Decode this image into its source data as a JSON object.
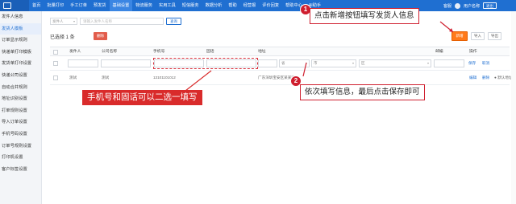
{
  "nav": {
    "items": [
      "首页",
      "批量打印",
      "手工订单",
      "预发货",
      "基础设置",
      "物流服务",
      "实用工具",
      "短信服务",
      "数据分析",
      "帮助",
      "经营报",
      "评价回复",
      "帮助中心",
      "AI助手"
    ],
    "active_index": 4,
    "right": {
      "label1": "客服",
      "user": "用户名称",
      "btn": "退出"
    }
  },
  "sidebar": {
    "items": [
      "发件人信息",
      "发货人模板",
      "订单显示规则",
      "快递单打印模板",
      "发货单打印设置",
      "快递公司设置",
      "自动合并规则",
      "地址识别设置",
      "打单规则设置",
      "导入订单设置",
      "手机号码设置",
      "订单号规则设置",
      "打印机设置",
      "客户标签设置"
    ],
    "active_index": 1
  },
  "search": {
    "select_value": "发件人",
    "input_placeholder": "请输入发件人名称",
    "button": "查询"
  },
  "toolbar": {
    "selected_text": "已选择 1 条",
    "delete": "删除",
    "add": "新增",
    "import": "导入",
    "export": "导出"
  },
  "table": {
    "headers": [
      "发件人",
      "公司名称",
      "手机号",
      "固话",
      "地址",
      "邮编",
      "操作"
    ],
    "edit_row": {
      "province": "省",
      "city": "市",
      "district": "区",
      "save": "保存",
      "cancel": "取消"
    },
    "data_row": {
      "name": "测试",
      "company": "测试",
      "phone": "13101101012",
      "address": "广东深圳宝安区某某路",
      "edit": "编辑",
      "delete": "删除",
      "default": "默认地址"
    }
  },
  "callouts": {
    "step1_num": "1",
    "step1_text": "点击新增按钮填写发货人信息",
    "step2_num": "2",
    "step2_text": "依次填写信息，最后点击保存即可",
    "phone_hint": "手机号和固话可以二选一填写"
  },
  "colors": {
    "brand": "#1f6fd1",
    "accent_orange": "#ff7a1a",
    "callout_red": "#d92b2b"
  }
}
